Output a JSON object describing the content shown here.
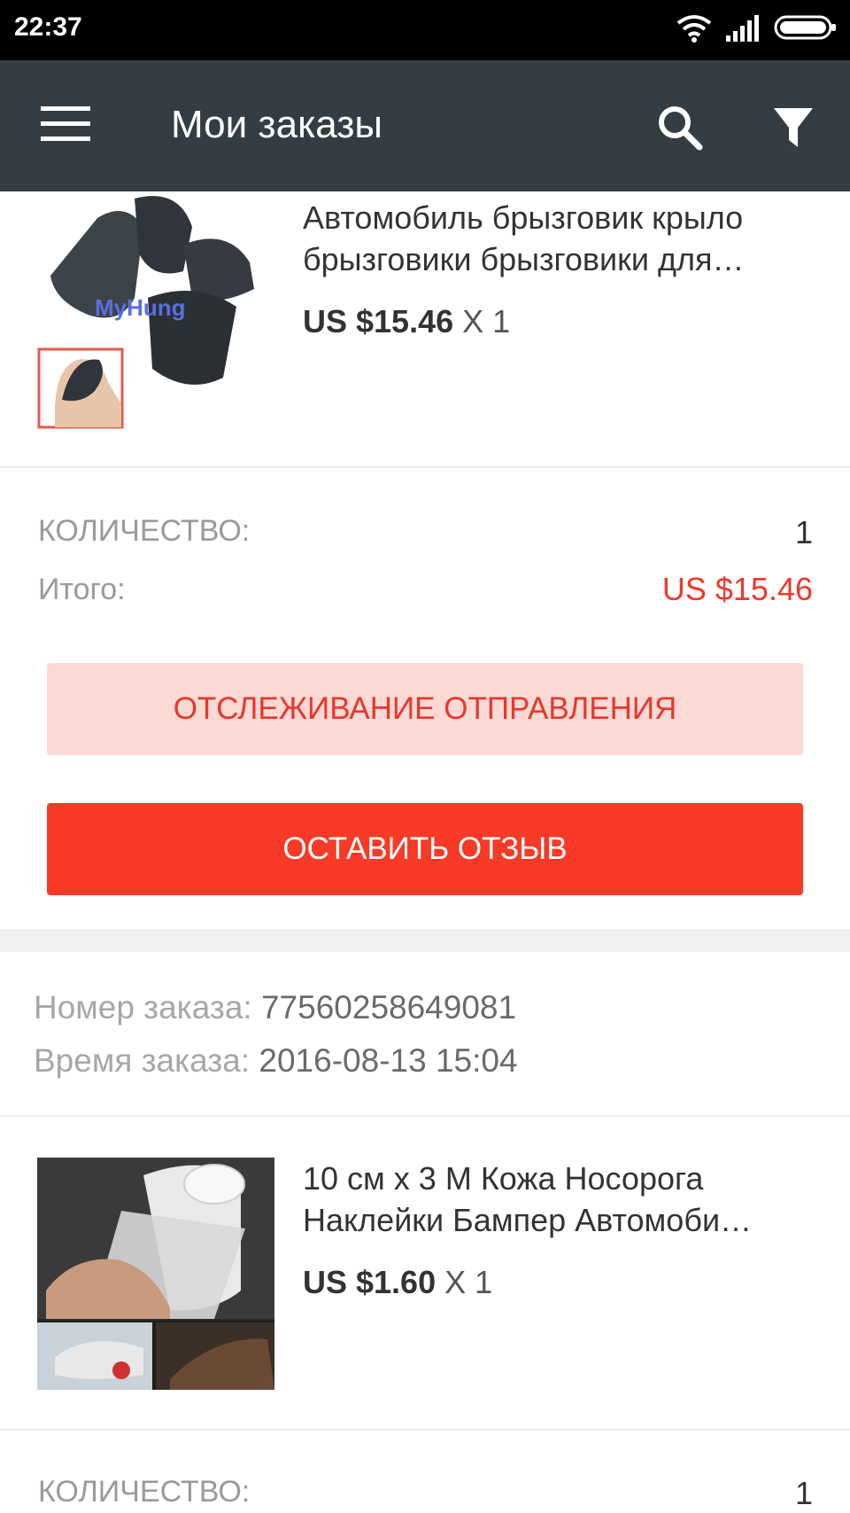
{
  "status_bar": {
    "time": "22:37"
  },
  "app_bar": {
    "title": "Мои заказы"
  },
  "order1": {
    "product": {
      "title_line1": "Автомобиль брызговик крыло",
      "title_line2": "брызговики брызговики для…",
      "price": "US $15.46",
      "multiplier": "X 1",
      "watermark": "MyHung"
    },
    "quantity_label": "КОЛИЧЕСТВО:",
    "quantity_value": "1",
    "total_label": "Итого:",
    "total_value": "US $15.46",
    "track_button": "ОТСЛЕЖИВАНИЕ ОТПРАВЛЕНИЯ",
    "review_button": "ОСТАВИТЬ ОТЗЫВ"
  },
  "order2": {
    "number_label": "Номер заказа: ",
    "number_value": "77560258649081",
    "time_label": "Время заказа: ",
    "time_value": "2016-08-13 15:04",
    "product": {
      "title_line1": "10 см х 3 М Кожа Носорога",
      "title_line2": "Наклейки Бампер Автомоби…",
      "price": "US $1.60",
      "multiplier": "X 1"
    },
    "quantity_label": "КОЛИЧЕСТВО:",
    "quantity_value": "1"
  },
  "colors": {
    "accent": "#f93a26",
    "accent_light": "#fbd9d5",
    "appbar": "#343d43"
  }
}
